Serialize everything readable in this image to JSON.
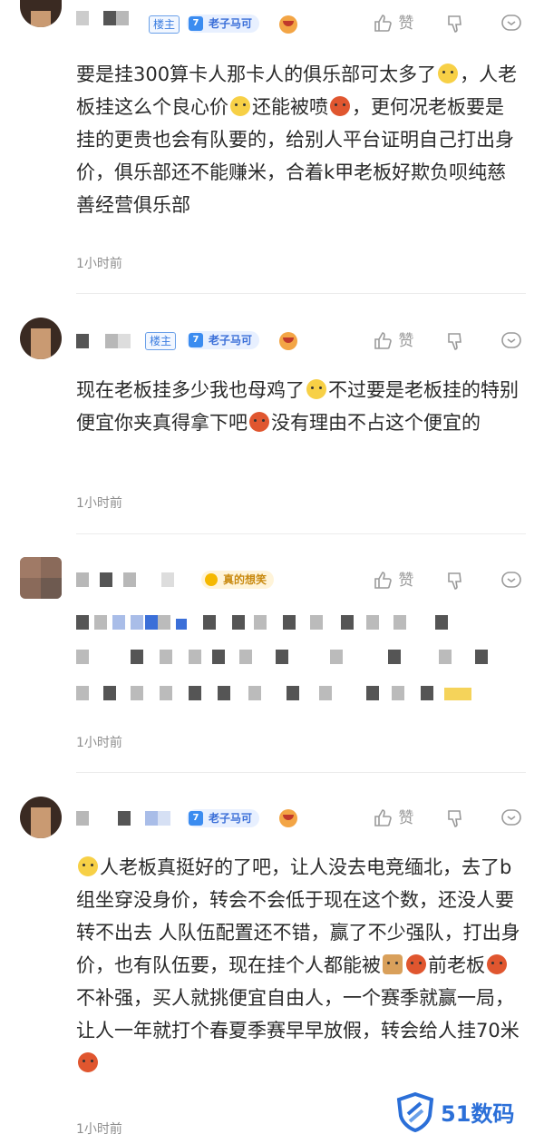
{
  "comments": [
    {
      "host_badge": "楼主",
      "fan_level": "7",
      "fan_name": "老子马可",
      "text": "要是挂300算卡人那卡人的俱乐部可太多了",
      "text2": "，人老板挂这么个良心价",
      "text3": "还能被喷",
      "text4": "，更何况老板要是挂的更贵也会有队要的，给别人平台证明自己打出身价，俱乐部还不能赚米，合着k甲老板好欺负呗纯慈善经营俱乐部",
      "time": "1小时前",
      "like_label": "赞"
    },
    {
      "host_badge": "楼主",
      "fan_level": "7",
      "fan_name": "老子马可",
      "text": "现在老板挂多少我也母鸡了",
      "text2": "不过要是老板挂的特别便宜你夹真得拿下吧",
      "text3": "没有理由不占这个便宜的",
      "time": "1小时前",
      "like_label": "赞"
    },
    {
      "gold_badge": "真的想笑",
      "time": "1小时前",
      "like_label": "赞"
    },
    {
      "fan_level": "7",
      "fan_name": "老子马可",
      "text": "人老板真挺好的了吧，让人没去电竞缅北，去了b组坐穿没身价，转会不会低于现在这个数，还没人要转不出去 人队伍配置还不错，赢了不少强队，打出身价，也有队伍要，现在挂个人都能被",
      "text2": "前老板",
      "text3": "不补强，买人就挑便宜自由人，一个赛季就赢一局，让人一年就打个春夏季赛早早放假，转会给人挂70米",
      "time": "1小时前",
      "like_label": "赞"
    }
  ],
  "watermark": "51数码",
  "colors": {
    "accent": "#3b7de0",
    "watermark": "#2b6fd8",
    "gold": "#c98a10"
  }
}
